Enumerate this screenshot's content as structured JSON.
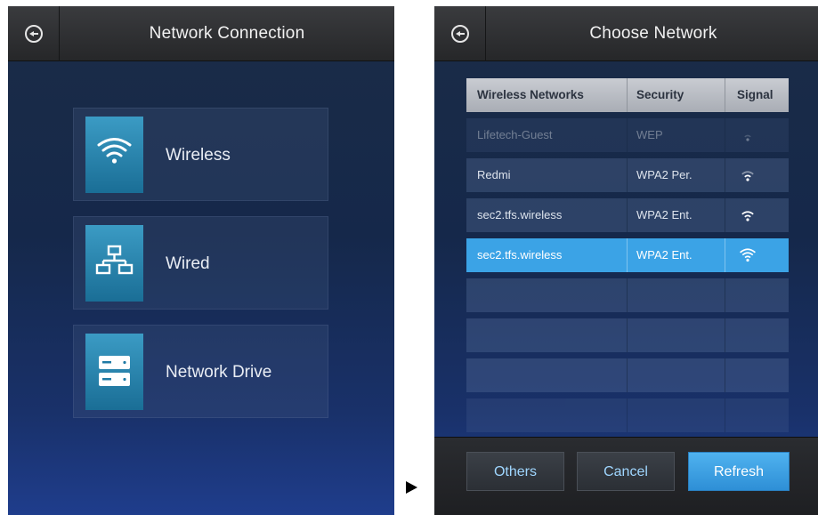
{
  "left_screen": {
    "title": "Network Connection",
    "menu": [
      {
        "label": "Wireless",
        "icon": "wifi-icon"
      },
      {
        "label": "Wired",
        "icon": "network-tree-icon"
      },
      {
        "label": "Network Drive",
        "icon": "server-drive-icon"
      }
    ]
  },
  "right_screen": {
    "title": "Choose Network",
    "table": {
      "headers": [
        "Wireless Networks",
        "Security",
        "Signal"
      ],
      "rows": [
        {
          "name": "Lifetech-Guest",
          "security": "WEP",
          "signal_bars": 1,
          "state": "faded"
        },
        {
          "name": "Redmi",
          "security": "WPA2 Per.",
          "signal_bars": 2,
          "state": "normal"
        },
        {
          "name": "sec2.tfs.wireless",
          "security": "WPA2 Ent.",
          "signal_bars": 3,
          "state": "normal"
        },
        {
          "name": "sec2.tfs.wireless",
          "security": "WPA2 Ent.",
          "signal_bars": 4,
          "state": "selected"
        }
      ]
    },
    "buttons": {
      "others": "Others",
      "cancel": "Cancel",
      "refresh": "Refresh"
    }
  },
  "colors": {
    "accent": "#3ba3e6",
    "tile": "#2a86b2",
    "background": "#17294a"
  }
}
